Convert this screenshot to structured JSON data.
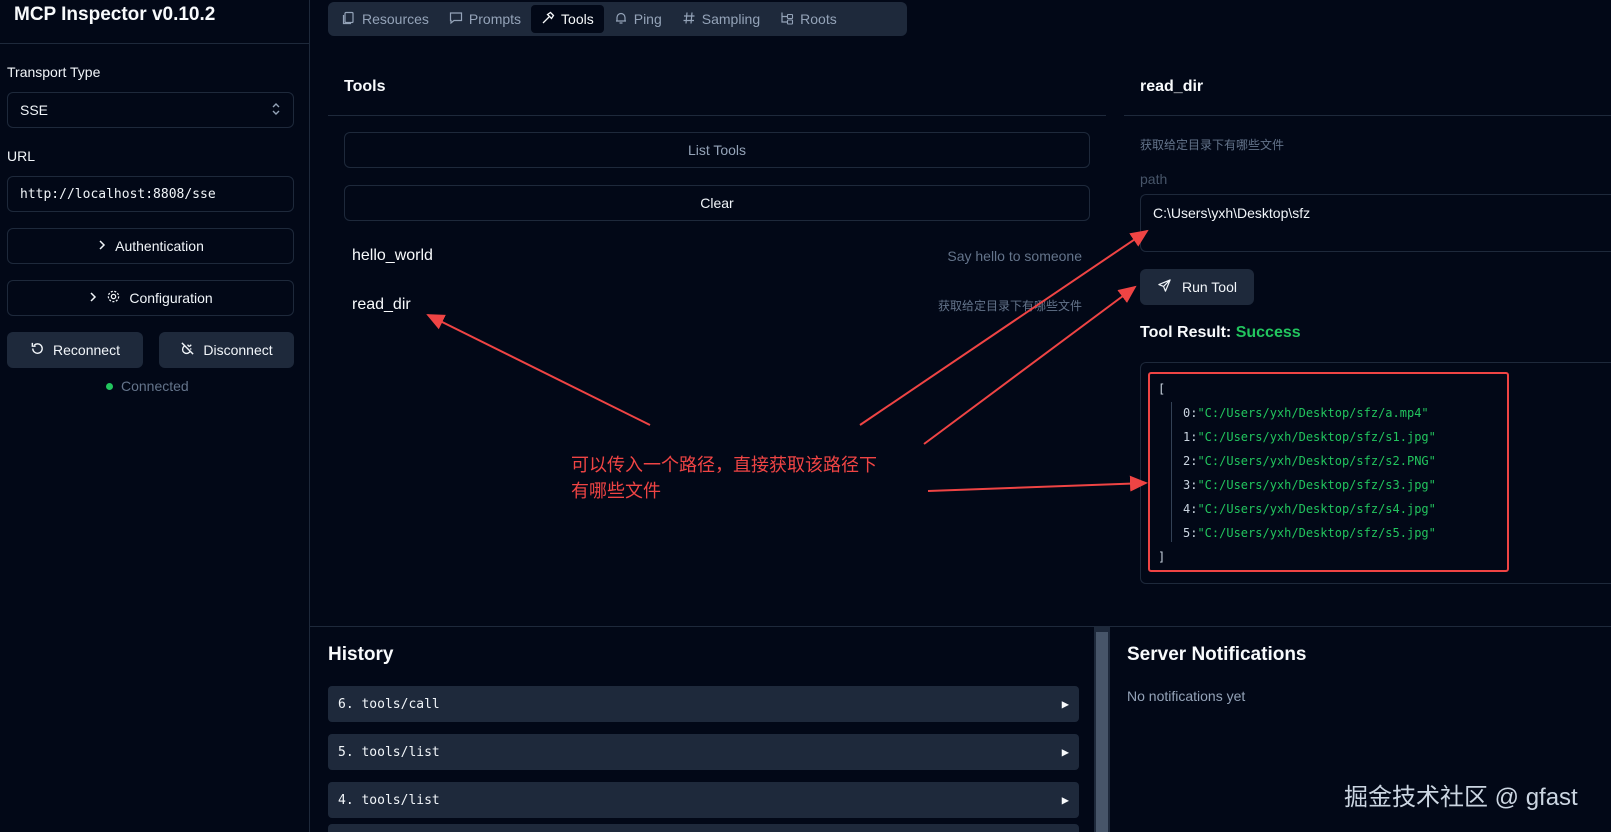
{
  "app": {
    "title": "MCP Inspector v0.10.2"
  },
  "sidebar": {
    "transport_label": "Transport Type",
    "transport_value": "SSE",
    "url_label": "URL",
    "url_value": "http://localhost:8808/sse",
    "authentication_label": "Authentication",
    "configuration_label": "Configuration",
    "reconnect_label": "Reconnect",
    "disconnect_label": "Disconnect",
    "status": "Connected"
  },
  "tabs": [
    {
      "label": "Resources",
      "icon": "files-icon"
    },
    {
      "label": "Prompts",
      "icon": "message-square-icon"
    },
    {
      "label": "Tools",
      "icon": "hammer-icon",
      "active": true
    },
    {
      "label": "Ping",
      "icon": "bell-icon"
    },
    {
      "label": "Sampling",
      "icon": "hash-icon"
    },
    {
      "label": "Roots",
      "icon": "folder-tree-icon"
    }
  ],
  "tools_panel": {
    "title": "Tools",
    "list_tools_label": "List Tools",
    "clear_label": "Clear",
    "items": [
      {
        "name": "hello_world",
        "description": "Say hello to someone"
      },
      {
        "name": "read_dir",
        "description": "获取给定目录下有哪些文件"
      }
    ]
  },
  "tool_detail": {
    "title": "read_dir",
    "description": "获取给定目录下有哪些文件",
    "param_label": "path",
    "param_value": "C:\\Users\\yxh\\Desktop\\sfz",
    "run_label": "Run Tool",
    "result_label": "Tool Result:",
    "result_status": "Success",
    "result_open": "[",
    "result_close": "]",
    "result_items": [
      {
        "index": "0:",
        "value": "\"C:/Users/yxh/Desktop/sfz/a.mp4\""
      },
      {
        "index": "1:",
        "value": "\"C:/Users/yxh/Desktop/sfz/s1.jpg\""
      },
      {
        "index": "2:",
        "value": "\"C:/Users/yxh/Desktop/sfz/s2.PNG\""
      },
      {
        "index": "3:",
        "value": "\"C:/Users/yxh/Desktop/sfz/s3.jpg\""
      },
      {
        "index": "4:",
        "value": "\"C:/Users/yxh/Desktop/sfz/s4.jpg\""
      },
      {
        "index": "5:",
        "value": "\"C:/Users/yxh/Desktop/sfz/s5.jpg\""
      }
    ]
  },
  "annotation": {
    "line1": "可以传入一个路径，直接获取该路径下",
    "line2": "有哪些文件",
    "color": "#ef4444"
  },
  "history": {
    "title": "History",
    "items": [
      {
        "label": "6. tools/call"
      },
      {
        "label": "5. tools/list"
      },
      {
        "label": "4. tools/list"
      }
    ]
  },
  "notifications": {
    "title": "Server Notifications",
    "empty_text": "No notifications yet"
  },
  "watermark": "掘金技术社区 @ gfast",
  "colors": {
    "background": "#020817",
    "panel": "#1e293b",
    "success": "#22c55e",
    "annotation": "#ef4444"
  }
}
